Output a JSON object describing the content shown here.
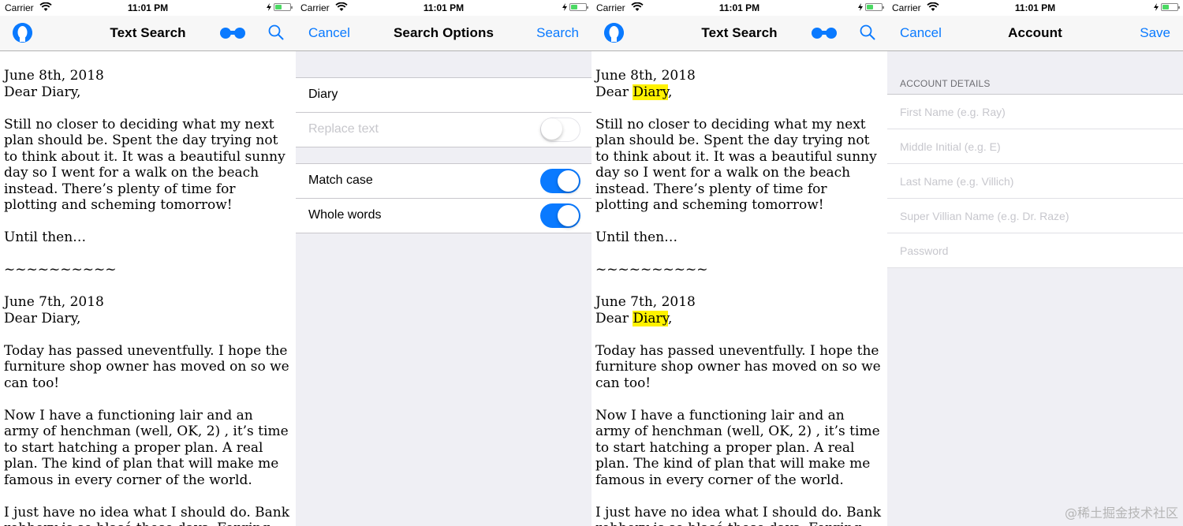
{
  "status": {
    "carrier": "Carrier",
    "time": "11:01 PM"
  },
  "text_search": {
    "title": "Text Search",
    "paragraphs": [
      [
        "June 8th, 2018",
        "Dear Diary,"
      ],
      [
        "Still no closer to deciding what my next plan should be. Spent the day trying not to think about it. It was a beautiful sunny day so I went for a walk on the beach instead. There’s plenty of time for plotting and scheming tomorrow!"
      ],
      [
        "Until then…"
      ],
      [
        "~~~~~~~~~~"
      ],
      [
        "June 7th, 2018",
        "Dear Diary,"
      ],
      [
        "Today has passed uneventfully. I hope the furniture shop owner has moved on so we can too!"
      ],
      [
        "Now I have a functioning lair and an army of henchman (well, OK, 2) , it’s time to start hatching a proper plan. A real plan. The kind of plan that will make me famous in every corner of the world."
      ],
      [
        "I just have no idea what I should do. Bank robbery is so blasé these days. Forging"
      ]
    ]
  },
  "search_options": {
    "title": "Search Options",
    "cancel_label": "Cancel",
    "search_label": "Search",
    "query": "Diary",
    "replace_label": "Replace text",
    "replace_on": false,
    "match_case_label": "Match case",
    "match_case_on": true,
    "whole_words_label": "Whole words",
    "whole_words_on": true
  },
  "highlighted": {
    "date1": "June 8th, 2018",
    "dear": "Dear ",
    "term": "Diary",
    "comma": ",",
    "date2": "June 7th, 2018"
  },
  "account": {
    "title": "Account",
    "cancel_label": "Cancel",
    "save_label": "Save",
    "section_header": "ACCOUNT DETAILS",
    "fields": [
      {
        "placeholder": "First Name (e.g. Ray)",
        "value": ""
      },
      {
        "placeholder": "Middle Initial (e.g. E)",
        "value": ""
      },
      {
        "placeholder": "Last Name (e.g. Villich)",
        "value": ""
      },
      {
        "placeholder": "Super Villian Name (e.g. Dr. Raze)",
        "value": ""
      },
      {
        "placeholder": "Password",
        "value": ""
      }
    ]
  },
  "watermark": "@稀土掘金技术社区",
  "colors": {
    "accent": "#0a7aff",
    "highlight": "#fff200",
    "toggle_off": "#ffffff",
    "grouped_bg": "#efeff4"
  },
  "icons": {
    "profile": "profile-icon",
    "binoculars": "binoculars-icon",
    "search": "search-icon",
    "wifi": "wifi-icon",
    "battery": "battery-icon",
    "bolt": "charging-bolt-icon"
  }
}
